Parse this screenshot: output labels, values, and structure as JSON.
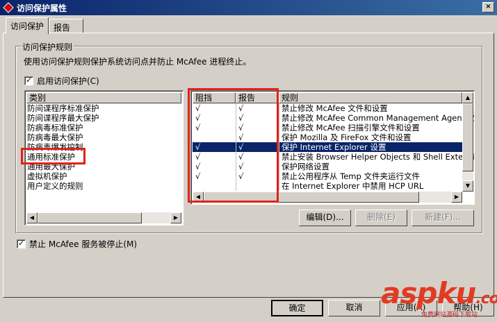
{
  "window": {
    "title": "访问保护属性",
    "close_glyph": "×"
  },
  "tabs": [
    {
      "label": "访问保护"
    },
    {
      "label": "报告"
    }
  ],
  "group": {
    "legend": "访问保护规则",
    "description": "使用访问保护规则保护系统访问点并防止 McAfee 进程终止。",
    "enable_label": "启用访问保护(C)",
    "enable_checked": true
  },
  "categories": {
    "header": "类别",
    "items": [
      "防间谍程序标准保护",
      "防间谍程序最大保护",
      "防病毒标准保护",
      "防病毒最大保护",
      "防病毒爆发控制",
      "通用标准保护",
      "通用最大保护",
      "虚拟机保护",
      "用户定义的规则"
    ]
  },
  "rules": {
    "headers": {
      "block": "阻挡",
      "report": "报告",
      "rule": "规则"
    },
    "check_glyph": "√",
    "items": [
      {
        "block": true,
        "report": true,
        "rule": "禁止修改 McAfee 文件和设置"
      },
      {
        "block": true,
        "report": true,
        "rule": "禁止修改 McAfee Common Management Agent 文件和"
      },
      {
        "block": true,
        "report": true,
        "rule": "禁止修改 McAfee 扫描引擎文件和设置"
      },
      {
        "block": false,
        "report": true,
        "rule": "保护 Mozilla 及 FireFox 文件和设置"
      },
      {
        "block": true,
        "report": true,
        "rule": "保护 Internet Explorer 设置"
      },
      {
        "block": true,
        "report": true,
        "rule": "禁止安装 Browser Helper Objects 和 Shell Extensions"
      },
      {
        "block": true,
        "report": true,
        "rule": "保护网络设置"
      },
      {
        "block": true,
        "report": true,
        "rule": "禁止公用程序从 Temp 文件夹运行文件"
      },
      {
        "block": false,
        "report": false,
        "rule": "在 Internet Explorer 中禁用 HCP URL"
      }
    ]
  },
  "rule_buttons": {
    "edit": "编辑(D)...",
    "delete": "删除(E)",
    "new": "新建(F)..."
  },
  "prevent_stop": {
    "label": "禁止 McAfee 服务被停止(M)",
    "checked": true
  },
  "dialog_buttons": {
    "ok": "确定",
    "cancel": "取消",
    "apply": "应用(A)",
    "help": "帮助(H)"
  },
  "watermark": {
    "text_asp": "asp",
    "text_ku": "ku",
    "text_com": ".com",
    "subtitle": "免费网站源码下载站"
  },
  "colors": {
    "selection": "#0a246a",
    "highlight_box": "#e0211a",
    "titlebar": "#0a246a"
  }
}
